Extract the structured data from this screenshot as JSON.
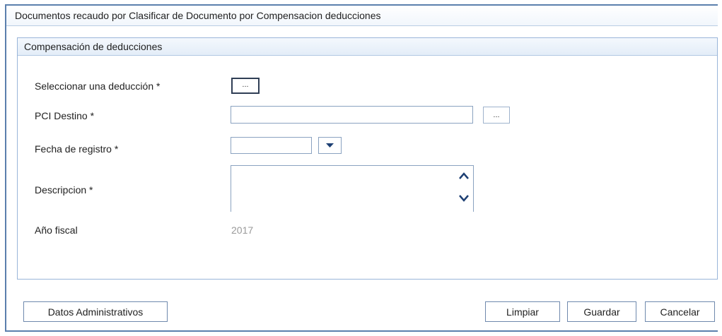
{
  "window": {
    "title": "Documentos recaudo por Clasificar de Documento por Compensacion deducciones"
  },
  "panel": {
    "title": "Compensación de deducciones"
  },
  "form": {
    "deduccion": {
      "label": "Seleccionar una deducción *",
      "button": "..."
    },
    "pci_destino": {
      "label": "PCI Destino *",
      "value": "",
      "button": "..."
    },
    "fecha_registro": {
      "label": "Fecha de registro *",
      "value": "",
      "dropdown_icon": "caret-down-icon"
    },
    "descripcion": {
      "label": "Descripcion *",
      "value": "",
      "scroll_up_icon": "chevron-up-icon",
      "scroll_down_icon": "chevron-down-icon"
    },
    "anio_fiscal": {
      "label": "Año fiscal",
      "value": "2017"
    }
  },
  "buttons": {
    "datos_administrativos": "Datos Administrativos",
    "limpiar": "Limpiar",
    "guardar": "Guardar",
    "cancelar": "Cancelar"
  }
}
